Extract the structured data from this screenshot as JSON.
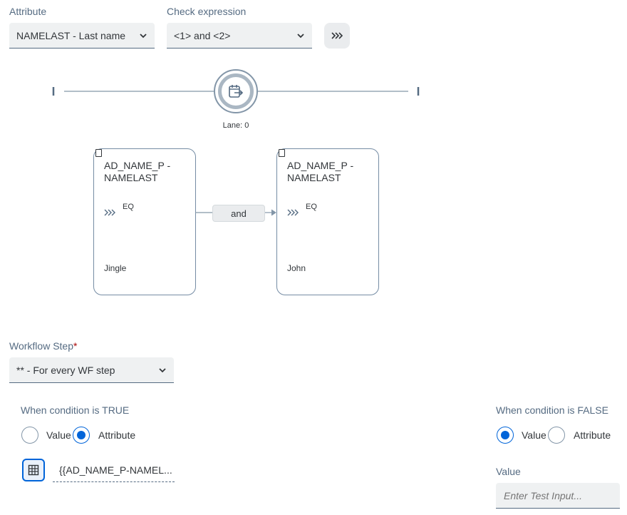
{
  "attribute": {
    "label": "Attribute",
    "value": "NAMELAST - Last name"
  },
  "check_expression": {
    "label": "Check expression",
    "value": "<1> and <2>"
  },
  "lane": {
    "label": "Lane: 0"
  },
  "nodes": [
    {
      "title": "AD_NAME_P - NAMELAST",
      "operator": "EQ",
      "value": "Jingle"
    },
    {
      "title": "AD_NAME_P - NAMELAST",
      "operator": "EQ",
      "value": "John"
    }
  ],
  "connector": {
    "label": "and"
  },
  "workflow_step": {
    "label": "Workflow Step",
    "required_mark": "*",
    "value": "** - For every WF step"
  },
  "when_true": {
    "label": "When condition is TRUE",
    "option_value": "Value",
    "option_attribute": "Attribute",
    "selected": "Attribute",
    "attribute_value": "{{AD_NAME_P-NAMEL..."
  },
  "when_false": {
    "label": "When condition is FALSE",
    "option_value": "Value",
    "option_attribute": "Attribute",
    "selected": "Value",
    "value_label": "Value",
    "input_placeholder": "Enter Test Input..."
  },
  "colors": {
    "accent": "#0064d9",
    "line": "#8396a8",
    "text_muted": "#556b82"
  }
}
